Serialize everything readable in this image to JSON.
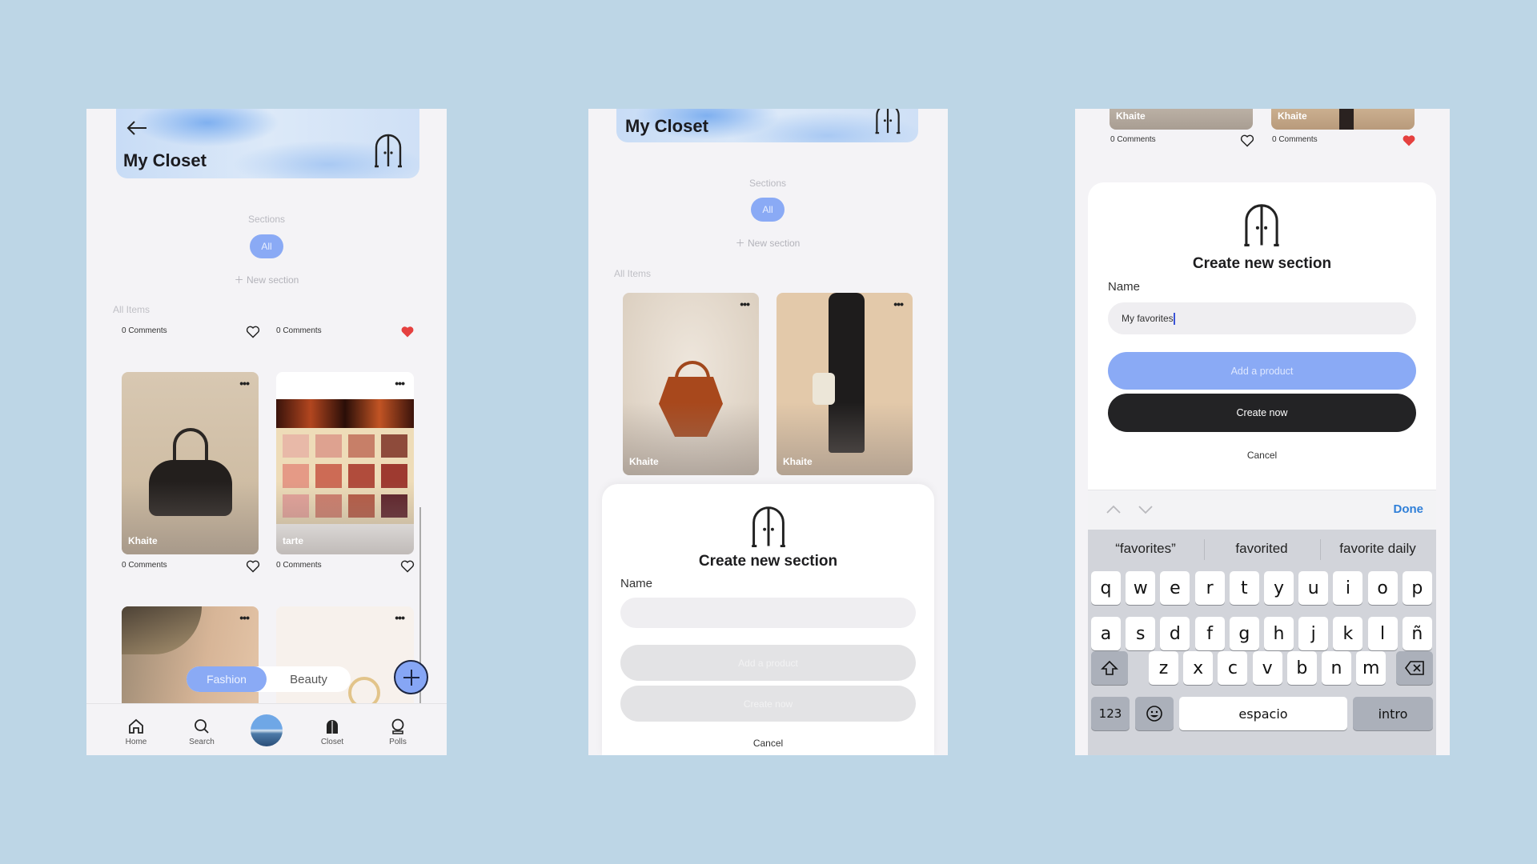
{
  "colors": {
    "background": "#bdd6e6",
    "accent": "#8aaaf5",
    "dark_button": "#232325",
    "heart_red": "#e5403f",
    "done_blue": "#2f7fd8"
  },
  "screen1": {
    "header": {
      "title": "My Closet",
      "back_icon": "arrow-left-icon",
      "closet_icon": "wardrobe-icon"
    },
    "sections_label": "Sections",
    "section_pills": [
      {
        "label": "All",
        "selected": true
      }
    ],
    "new_section": "New section",
    "all_items_label": "All Items",
    "top_row": [
      {
        "comments": "0 Comments",
        "liked": false
      },
      {
        "comments": "0 Comments",
        "liked": true
      }
    ],
    "cards": [
      {
        "brand": "Khaite",
        "comments": "0 Comments",
        "liked": false
      },
      {
        "brand": "tarte",
        "comments": "0 Comments",
        "liked": false
      },
      {
        "brand": "",
        "comments": "",
        "liked": false
      },
      {
        "brand": "",
        "comments": "",
        "liked": false
      }
    ],
    "category_toggle": [
      {
        "label": "Fashion",
        "selected": true
      },
      {
        "label": "Beauty",
        "selected": false
      }
    ],
    "nav": [
      {
        "label": "Home",
        "icon": "home-icon"
      },
      {
        "label": "Search",
        "icon": "search-icon"
      },
      {
        "label": "",
        "icon": "profile-avatar"
      },
      {
        "label": "Closet",
        "icon": "closet-icon"
      },
      {
        "label": "Polls",
        "icon": "crystal-ball-icon"
      }
    ]
  },
  "screen2": {
    "header": {
      "title": "My Closet"
    },
    "sections_label": "Sections",
    "section_pills": [
      {
        "label": "All",
        "selected": true
      }
    ],
    "new_section": "New section",
    "all_items_label": "All Items",
    "cards": [
      {
        "brand": "Khaite"
      },
      {
        "brand": "Khaite"
      }
    ],
    "sheet": {
      "title": "Create new section",
      "name_label": "Name",
      "name_value": "",
      "add_product": "Add a product",
      "create_now": "Create now",
      "cancel": "Cancel",
      "buttons_enabled": false
    }
  },
  "screen3": {
    "cards": [
      {
        "brand": "Khaite",
        "comments": "0 Comments",
        "liked": false
      },
      {
        "brand": "Khaite",
        "comments": "0 Comments",
        "liked": true
      }
    ],
    "sheet": {
      "title": "Create new section",
      "name_label": "Name",
      "name_value": "My favorites",
      "add_product": "Add a product",
      "create_now": "Create now",
      "cancel": "Cancel",
      "buttons_enabled": true
    },
    "keyboard": {
      "done": "Done",
      "suggestions": [
        "“favorites”",
        "favorited",
        "favorite daily"
      ],
      "rows": [
        [
          "q",
          "w",
          "e",
          "r",
          "t",
          "y",
          "u",
          "i",
          "o",
          "p"
        ],
        [
          "a",
          "s",
          "d",
          "f",
          "g",
          "h",
          "j",
          "k",
          "l",
          "ñ"
        ],
        [
          "z",
          "x",
          "c",
          "v",
          "b",
          "n",
          "m"
        ]
      ],
      "numbers": "123",
      "space": "espacio",
      "return": "intro"
    }
  }
}
